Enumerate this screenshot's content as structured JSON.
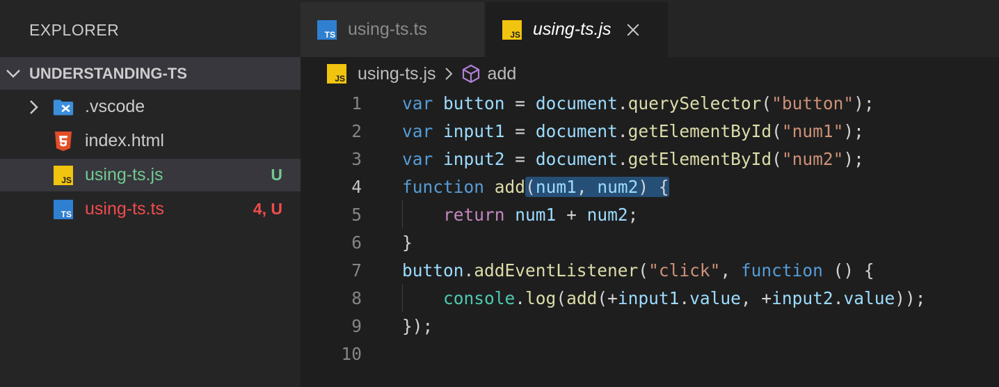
{
  "explorer": {
    "title": "EXPLORER",
    "section": "UNDERSTANDING-TS",
    "items": [
      {
        "label": ".vscode",
        "icon": "vscode-folder-icon",
        "badge": "",
        "color": "#cccccc"
      },
      {
        "label": "index.html",
        "icon": "html5-icon",
        "badge": "",
        "color": "#cccccc"
      },
      {
        "label": "using-ts.js",
        "icon": "js-file-icon",
        "badge": "U",
        "color": "#73c991"
      },
      {
        "label": "using-ts.ts",
        "icon": "ts-file-icon",
        "badge": "4, U",
        "color": "#f14c4c"
      }
    ]
  },
  "tabs": [
    {
      "label": "using-ts.ts",
      "icon": "ts-file-icon",
      "active": false
    },
    {
      "label": "using-ts.js",
      "icon": "js-file-icon",
      "active": true
    }
  ],
  "breadcrumb": {
    "file": "using-ts.js",
    "symbol": "add",
    "symbol_icon": "cube-icon"
  },
  "icon_text": {
    "js": "JS",
    "ts": "TS"
  },
  "colors": {
    "sidebar_bg": "#252526",
    "editor_bg": "#1e1e1e",
    "selection": "#264f78",
    "untracked": "#73c991",
    "error": "#f14c4c"
  },
  "code": {
    "line_numbers": [
      "1",
      "2",
      "3",
      "4",
      "5",
      "6",
      "7",
      "8",
      "9",
      "10"
    ],
    "lines": [
      "var button = document.querySelector(\"button\");",
      "var input1 = document.getElementById(\"num1\");",
      "var input2 = document.getElementById(\"num2\");",
      "function add(num1, num2) {",
      "    return num1 + num2;",
      "}",
      "button.addEventListener(\"click\", function () {",
      "    console.log(add(+input1.value, +input2.value));",
      "});",
      ""
    ]
  }
}
